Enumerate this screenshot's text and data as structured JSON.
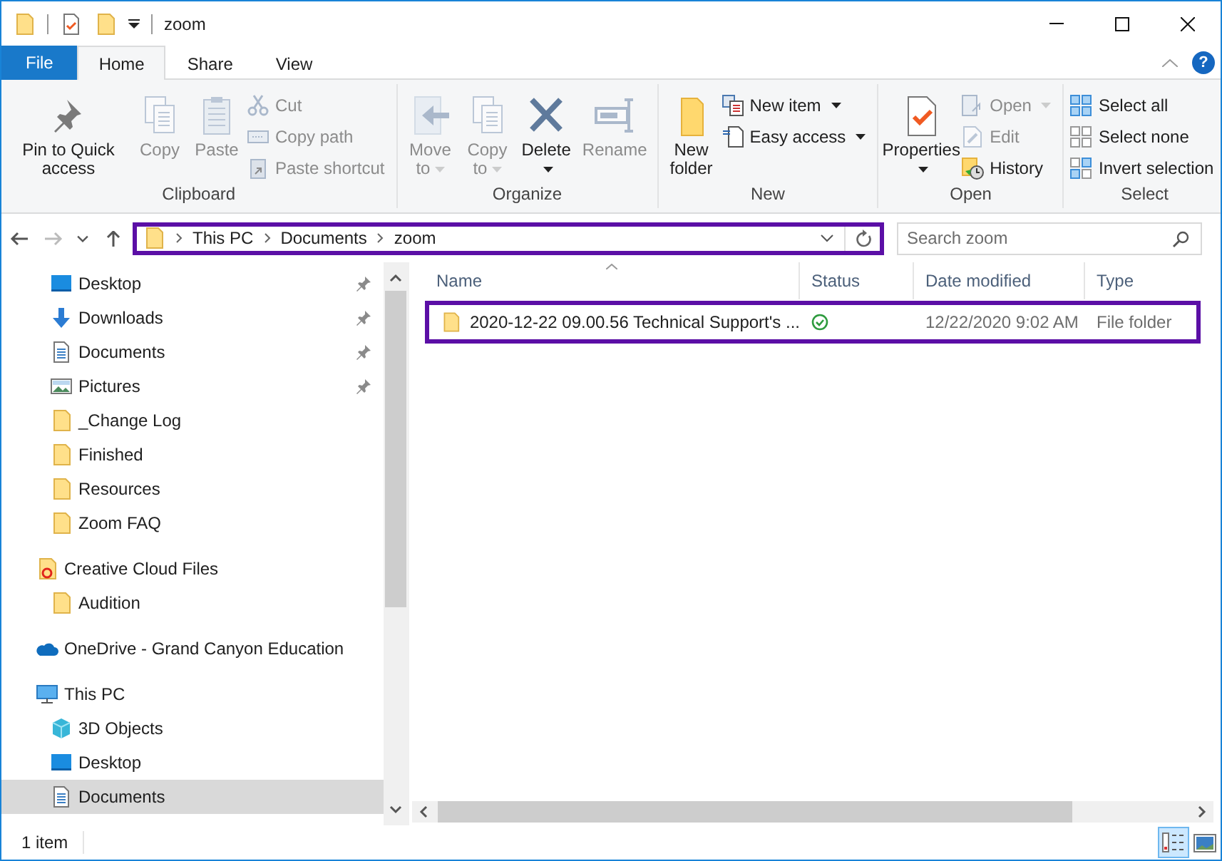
{
  "window": {
    "title": "zoom"
  },
  "ribbon_tabs": [
    {
      "label": "File",
      "kind": "file",
      "selected": false
    },
    {
      "label": "Home",
      "kind": "tab",
      "selected": true
    },
    {
      "label": "Share",
      "kind": "tab",
      "selected": false
    },
    {
      "label": "View",
      "kind": "tab",
      "selected": false
    }
  ],
  "help": {
    "label": "?"
  },
  "ribbon": {
    "groups": [
      {
        "label": "Clipboard",
        "large": [
          {
            "label": "Pin to Quick access",
            "disabled": false,
            "dropdown": false
          },
          {
            "label": "Copy",
            "disabled": true,
            "dropdown": false
          },
          {
            "label": "Paste",
            "disabled": true,
            "dropdown": false
          }
        ],
        "small": [
          {
            "label": "Cut",
            "disabled": true,
            "dropdown": false
          },
          {
            "label": "Copy path",
            "disabled": true,
            "dropdown": false
          },
          {
            "label": "Paste shortcut",
            "disabled": true,
            "dropdown": false
          }
        ]
      },
      {
        "label": "Organize",
        "large": [
          {
            "label": "Move to",
            "disabled": true,
            "dropdown": true
          },
          {
            "label": "Copy to",
            "disabled": true,
            "dropdown": true
          },
          {
            "label": "Delete",
            "disabled": false,
            "dropdown": true
          },
          {
            "label": "Rename",
            "disabled": true,
            "dropdown": false
          }
        ]
      },
      {
        "label": "New",
        "large": [
          {
            "label": "New folder",
            "disabled": false,
            "dropdown": false
          }
        ],
        "small": [
          {
            "label": "New item",
            "disabled": false,
            "dropdown": true
          },
          {
            "label": "Easy access",
            "disabled": false,
            "dropdown": true
          }
        ]
      },
      {
        "label": "Open",
        "large": [
          {
            "label": "Properties",
            "disabled": false,
            "dropdown": true
          }
        ],
        "small": [
          {
            "label": "Open",
            "disabled": true,
            "dropdown": true
          },
          {
            "label": "Edit",
            "disabled": true,
            "dropdown": false
          },
          {
            "label": "History",
            "disabled": false,
            "dropdown": false
          }
        ]
      },
      {
        "label": "Select",
        "small": [
          {
            "label": "Select all",
            "disabled": false,
            "dropdown": false
          },
          {
            "label": "Select none",
            "disabled": false,
            "dropdown": false
          },
          {
            "label": "Invert selection",
            "disabled": false,
            "dropdown": false
          }
        ]
      }
    ]
  },
  "navigation": [
    {
      "kind": "back",
      "disabled": false
    },
    {
      "kind": "forward",
      "disabled": true
    },
    {
      "kind": "recent",
      "disabled": false
    },
    {
      "kind": "up",
      "disabled": false
    }
  ],
  "address_bar": {
    "path": [
      "This PC",
      "Documents",
      "zoom"
    ],
    "highlighted": true
  },
  "search": {
    "placeholder": "Search zoom"
  },
  "nav_pane": {
    "quick_access": [
      {
        "label": "Desktop",
        "kind": "desktop",
        "pinned": true,
        "selected": false
      },
      {
        "label": "Downloads",
        "kind": "downloads",
        "pinned": true,
        "selected": false
      },
      {
        "label": "Documents",
        "kind": "documents",
        "pinned": true,
        "selected": false
      },
      {
        "label": "Pictures",
        "kind": "pictures",
        "pinned": true,
        "selected": false
      },
      {
        "label": "_Change Log",
        "kind": "folder",
        "pinned": false,
        "selected": false
      },
      {
        "label": "Finished",
        "kind": "folder",
        "pinned": false,
        "selected": false
      },
      {
        "label": "Resources",
        "kind": "folder",
        "pinned": false,
        "selected": false
      },
      {
        "label": "Zoom FAQ",
        "kind": "folder",
        "pinned": false,
        "selected": false
      }
    ],
    "tree": [
      {
        "label": "Creative Cloud Files",
        "kind": "cloud_folder",
        "selected": false,
        "children": [
          {
            "label": "Audition",
            "kind": "folder",
            "selected": false
          }
        ]
      },
      {
        "label": "OneDrive - Grand Canyon Education",
        "kind": "onedrive",
        "selected": false
      },
      {
        "label": "This PC",
        "kind": "pc",
        "selected": false,
        "children": [
          {
            "label": "3D Objects",
            "kind": "objects3d",
            "selected": false
          },
          {
            "label": "Desktop",
            "kind": "desktop",
            "selected": false
          },
          {
            "label": "Documents",
            "kind": "documents",
            "selected": true
          }
        ]
      }
    ]
  },
  "file_list": {
    "columns": [
      {
        "label": "Name",
        "sorted": true
      },
      {
        "label": "Status",
        "sorted": false
      },
      {
        "label": "Date modified",
        "sorted": false
      },
      {
        "label": "Type",
        "sorted": false
      }
    ],
    "rows": [
      {
        "name": "2020-12-22 09.00.56 Technical Support's ...",
        "synced": true,
        "date_modified": "12/22/2020 9:02 AM",
        "type": "File folder",
        "highlighted": true,
        "selected": false
      }
    ]
  },
  "status_bar": {
    "item_count": "1 item",
    "views": [
      {
        "kind": "details",
        "selected": true
      },
      {
        "kind": "large_icons",
        "selected": false
      }
    ]
  }
}
